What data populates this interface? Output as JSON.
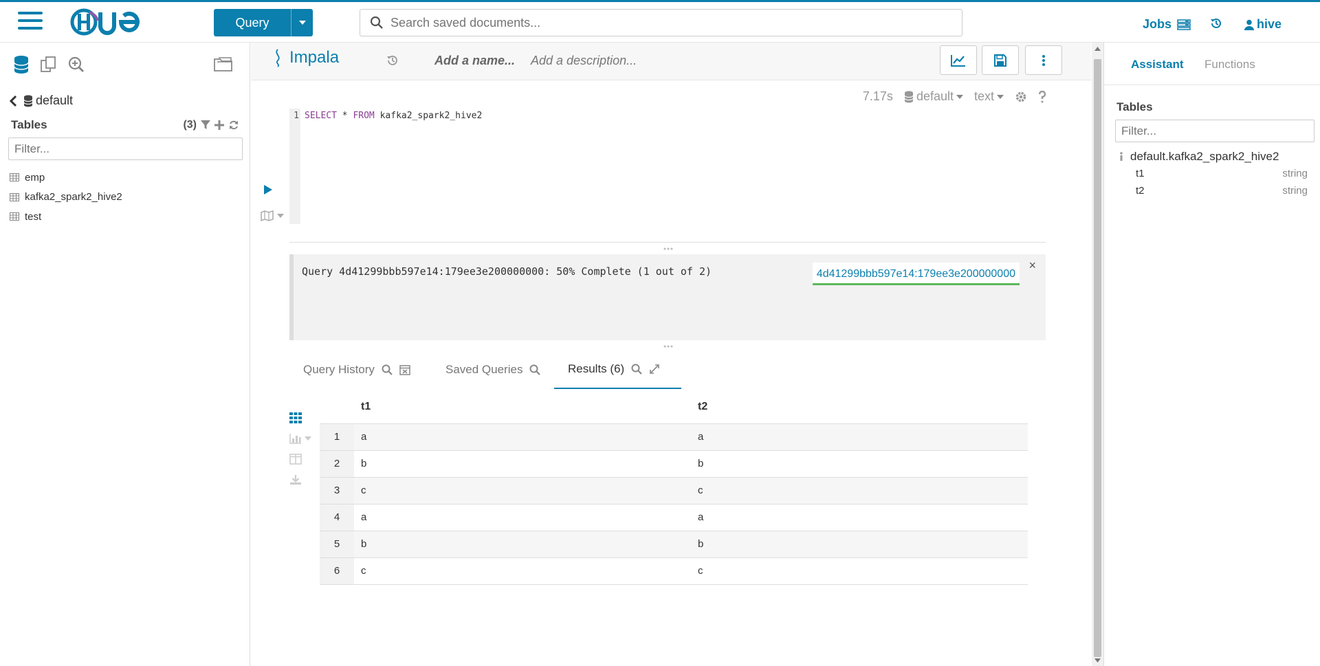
{
  "header": {
    "logo_text": "HUE",
    "query_button_label": "Query",
    "search_placeholder": "Search saved documents...",
    "jobs_label": "Jobs",
    "user_label": "hive"
  },
  "left_panel": {
    "database": "default",
    "tables_title": "Tables",
    "tables_count": "(3)",
    "filter_placeholder": "Filter...",
    "tables": [
      {
        "name": "emp"
      },
      {
        "name": "kafka2_spark2_hive2"
      },
      {
        "name": "test"
      }
    ]
  },
  "editor": {
    "engine": "Impala",
    "name_placeholder": "Add a name...",
    "description_placeholder": "Add a description...",
    "exec_time": "7.17s",
    "database": "default",
    "format": "text",
    "line_number": "1",
    "code": {
      "kw1": "SELECT",
      "star": " * ",
      "kw2": "FROM",
      "table": " kafka2_spark2_hive2"
    }
  },
  "status": {
    "message": "Query 4d41299bbb597e14:179ee3e200000000: 50% Complete (1 out of 2)",
    "job_id": "4d41299bbb597e14:179ee3e200000000",
    "close": "×"
  },
  "tabs": [
    {
      "label": "Query History"
    },
    {
      "label": "Saved Queries"
    },
    {
      "label": "Results (6)"
    }
  ],
  "results": {
    "columns": [
      "t1",
      "t2"
    ],
    "rows": [
      {
        "n": "1",
        "t1": "a",
        "t2": "a"
      },
      {
        "n": "2",
        "t1": "b",
        "t2": "b"
      },
      {
        "n": "3",
        "t1": "c",
        "t2": "c"
      },
      {
        "n": "4",
        "t1": "a",
        "t2": "a"
      },
      {
        "n": "5",
        "t1": "b",
        "t2": "b"
      },
      {
        "n": "6",
        "t1": "c",
        "t2": "c"
      }
    ]
  },
  "right_panel": {
    "tab_assistant": "Assistant",
    "tab_functions": "Functions",
    "tables_title": "Tables",
    "filter_placeholder": "Filter...",
    "table_name": "default.kafka2_spark2_hive2",
    "columns": [
      {
        "name": "t1",
        "type": "string"
      },
      {
        "name": "t2",
        "type": "string"
      }
    ]
  },
  "colors": {
    "accent": "#0b7fad",
    "progress": "#5cb85c"
  }
}
